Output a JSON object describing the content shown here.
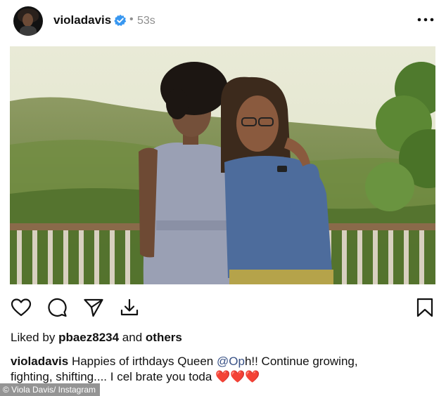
{
  "post": {
    "username": "violadavis",
    "dot": "•",
    "time": "53s",
    "verified": true
  },
  "icons": {
    "more": "more-options-icon",
    "like": "heart-icon",
    "comment": "comment-icon",
    "share": "send-icon",
    "download": "download-icon",
    "save": "bookmark-icon"
  },
  "likes": {
    "prefix": "Liked by",
    "user": "pbaez8234",
    "conj": "and",
    "others": "others"
  },
  "caption": {
    "username": "violadavis",
    "text_1": "Happies",
    "text_2": "of ",
    "text_3": "irthdays Queen",
    "mention": "@Op",
    "text_4": "h!! Continue growing,",
    "line2": "fighting, shifting....  I cel brate you toda",
    "hearts": "❤️❤️❤️"
  },
  "watermark": "© Viola Davis/ Instagram",
  "colors": {
    "verified": "#3897f0",
    "mention": "#385185",
    "heart": "#d0102e"
  }
}
